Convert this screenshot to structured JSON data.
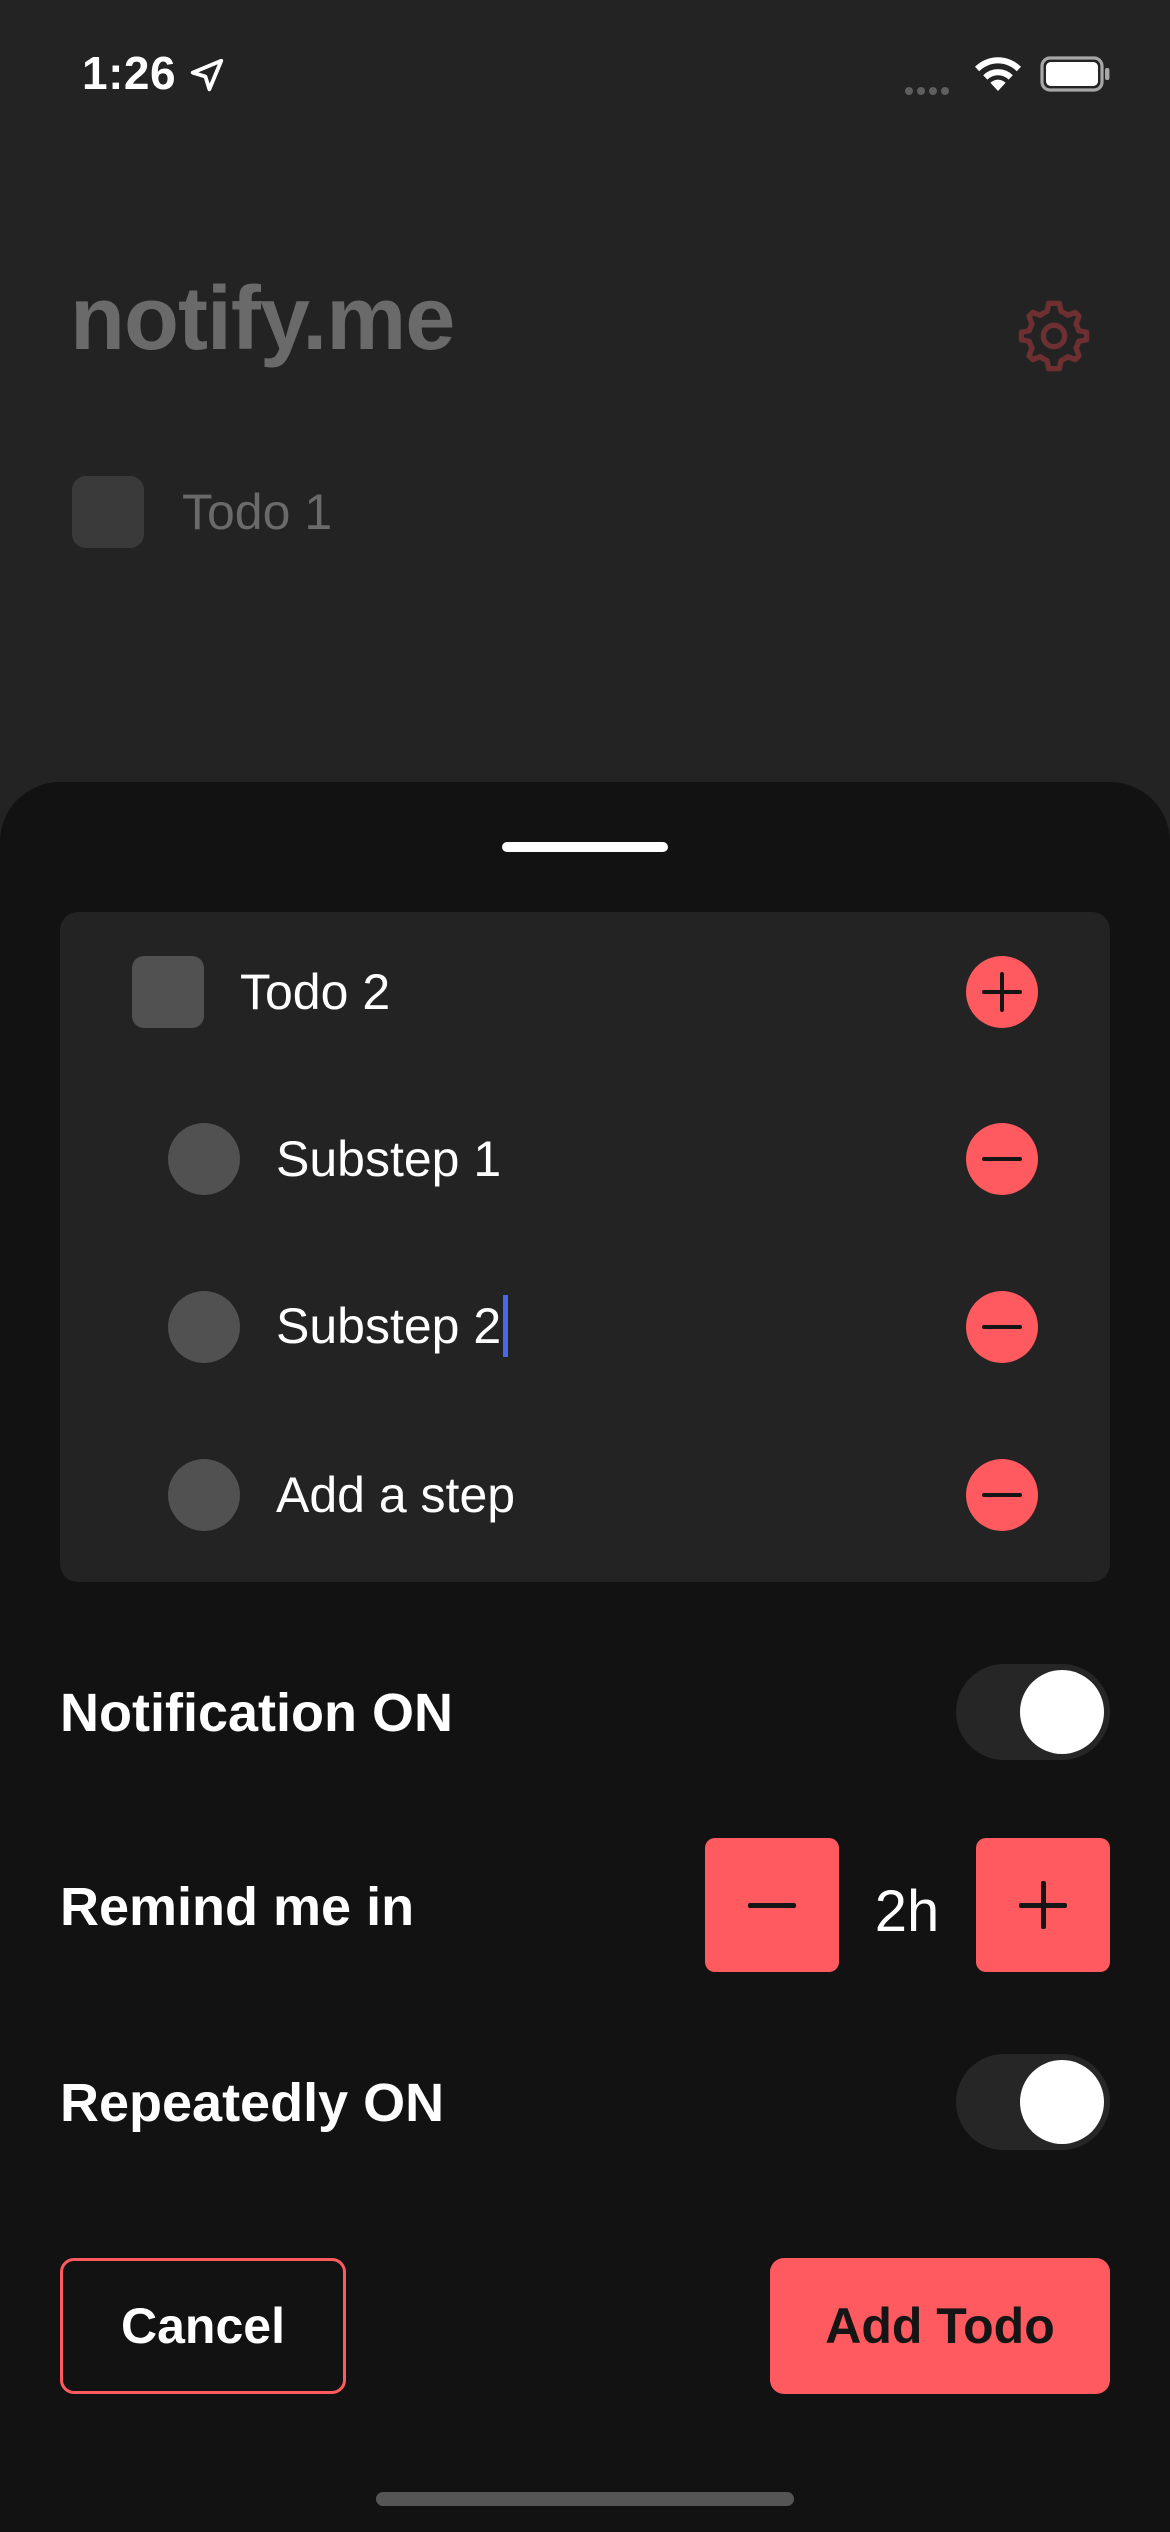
{
  "status_bar": {
    "time": "1:26",
    "icons": [
      "location-arrow-icon",
      "cellular-signal-icon",
      "wifi-icon",
      "battery-icon"
    ]
  },
  "background": {
    "app_title": "notify.me",
    "settings_icon": "gear-icon",
    "todos": [
      {
        "label": "Todo 1",
        "checked": false
      }
    ]
  },
  "sheet": {
    "todo": {
      "title": "Todo 2",
      "checked": false,
      "add_icon": "plus-icon"
    },
    "substeps": [
      {
        "text": "Substep 1",
        "remove_icon": "minus-icon"
      },
      {
        "text": "Substep 2",
        "remove_icon": "minus-icon",
        "editing": true
      },
      {
        "text": "Add a step",
        "remove_icon": "minus-icon"
      }
    ],
    "notification": {
      "label": "Notification ON",
      "on": true
    },
    "remind": {
      "label": "Remind me in",
      "value": "2h"
    },
    "repeat": {
      "label": "Repeatedly ON",
      "on": true
    },
    "cancel_label": "Cancel",
    "add_label": "Add Todo"
  },
  "colors": {
    "accent": "#fe5a5f",
    "background": "#232323",
    "sheet": "#121212",
    "card": "#232323",
    "caret": "#4868f0"
  }
}
